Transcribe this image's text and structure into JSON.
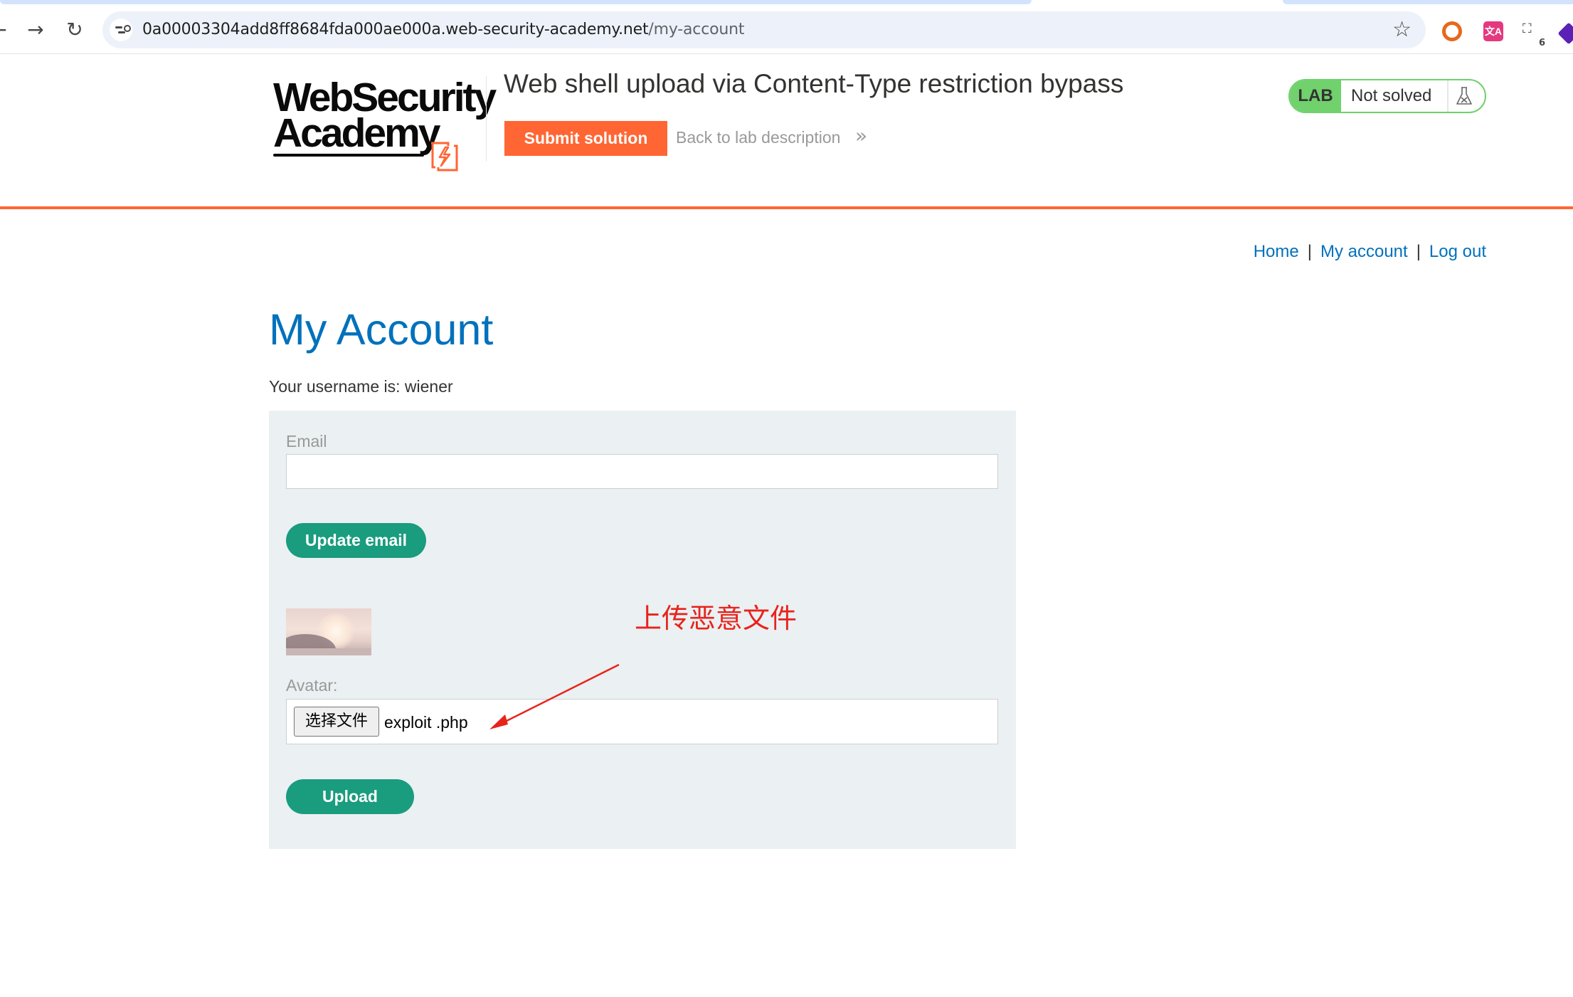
{
  "browser": {
    "url_host": "0a00003304add8ff8684fda000ae000a.web-security-academy.net",
    "url_path": "/my-account",
    "extension_badge_count": "6"
  },
  "lab_header": {
    "logo_line1": "WebSecurity",
    "logo_line2": "Academy",
    "title": "Web shell upload via Content-Type restriction bypass",
    "submit_label": "Submit solution",
    "back_label": "Back to lab description",
    "status_badge": "LAB",
    "status_text": "Not solved"
  },
  "nav": {
    "home": "Home",
    "my_account": "My account",
    "log_out": "Log out",
    "separator": "|"
  },
  "account": {
    "title": "My Account",
    "username_line": "Your username is: wiener",
    "email_label": "Email",
    "email_value": "",
    "update_email_label": "Update email",
    "avatar_label": "Avatar:",
    "choose_file_label": "选择文件",
    "chosen_file": "exploit .php",
    "upload_label": "Upload"
  },
  "annotation": {
    "text": "上传恶意文件",
    "color": "#e8231b"
  },
  "colors": {
    "brand_orange": "#ff6633",
    "link_blue": "#0071bc",
    "button_green": "#1a9c7e",
    "lab_green": "#70d16d",
    "panel_bg": "#ebf0f2"
  }
}
